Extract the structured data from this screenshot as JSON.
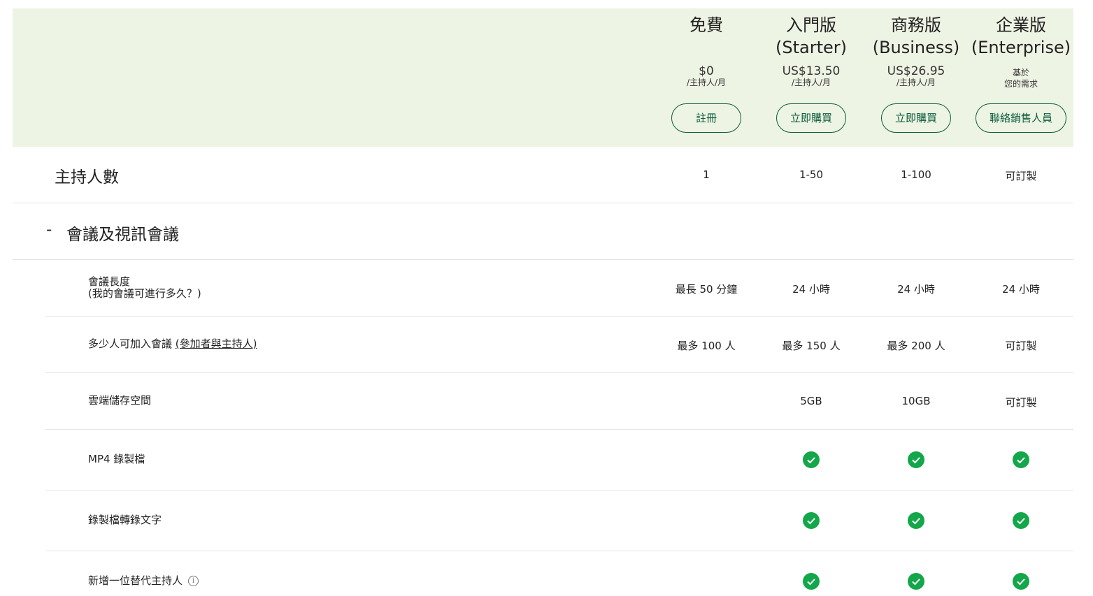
{
  "plans": [
    {
      "name": "免費",
      "price": "$0",
      "unit": "/主持人/月",
      "button": "註冊"
    },
    {
      "name": "入門版\n(Starter)",
      "price": "US$13.50",
      "unit": "/主持人/月",
      "button": "立即購買"
    },
    {
      "name": "商務版\n(Business)",
      "price": "US$26.95",
      "unit": "/主持人/月",
      "button": "立即購買"
    },
    {
      "name": "企業版\n(Enterprise)",
      "note": "基於\n您的需求",
      "button": "聯絡銷售人員"
    }
  ],
  "hosts_row": {
    "label": "主持人數",
    "values": [
      "1",
      "1-50",
      "1-100",
      "可訂製"
    ]
  },
  "section": {
    "toggle": "-",
    "title": "會議及視訊會議"
  },
  "features": [
    {
      "label": "會議長度",
      "sub": "(我的會議可進行多久？)",
      "values": [
        "最長 50 分鐘",
        "24 小時",
        "24 小時",
        "24 小時"
      ]
    },
    {
      "label_pre": "多少人可加入會議 ",
      "label_link": "(參加者與主持人)",
      "values": [
        "最多 100 人",
        "最多 150 人",
        "最多 200 人",
        "可訂製"
      ]
    },
    {
      "label": "雲端儲存空間",
      "values": [
        "",
        "5GB",
        "10GB",
        "可訂製"
      ]
    },
    {
      "label": "MP4 錄製檔",
      "checks": [
        false,
        true,
        true,
        true
      ]
    },
    {
      "label": "錄製檔轉錄文字",
      "checks": [
        false,
        true,
        true,
        true
      ]
    },
    {
      "label": "新增一位替代主持人",
      "info_icon": "info-icon",
      "checks": [
        false,
        true,
        true,
        true
      ]
    }
  ],
  "colors": {
    "header_bg": "#eef4e4",
    "accent": "#0a5c3c",
    "check": "#14a64a"
  }
}
